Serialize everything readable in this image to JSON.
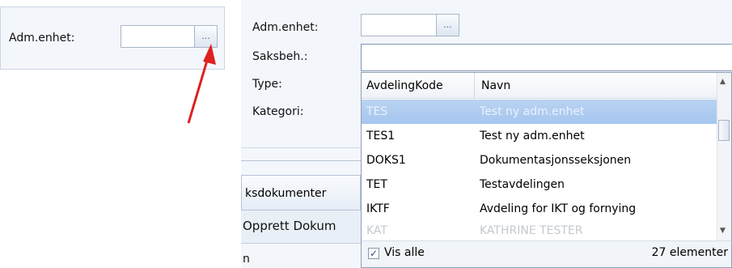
{
  "left_panel": {
    "adm_enhet_label": "Adm.enhet:",
    "browse_button": "..."
  },
  "right_panel": {
    "fields": {
      "adm_enhet_label": "Adm.enhet:",
      "saksbeh_label": "Saksbeh.:",
      "type_label": "Type:",
      "kategori_label": "Kategori:",
      "browse_button": "..."
    },
    "tabs": {
      "saksdokumenter": "ksdokumenter",
      "opprett": "Opprett Dokum",
      "bottom": "n"
    },
    "dropdown": {
      "columns": [
        "AvdelingKode",
        "Navn"
      ],
      "rows": [
        {
          "code": "TES",
          "name": "Test ny adm.enhet",
          "state": "selected"
        },
        {
          "code": "TES1",
          "name": "Test ny adm.enhet",
          "state": "normal"
        },
        {
          "code": "DOKS1",
          "name": "Dokumentasjonsseksjonen",
          "state": "normal"
        },
        {
          "code": "TET",
          "name": "Testavdelingen",
          "state": "normal"
        },
        {
          "code": "IKTF",
          "name": "Avdeling for IKT og fornying",
          "state": "normal"
        },
        {
          "code": "KAT",
          "name": "KATHRINE TESTER",
          "state": "dimmed"
        }
      ],
      "vis_alle_label": "Vis alle",
      "vis_alle_checked": true,
      "count_text": "27 elementer"
    }
  },
  "annotation": {
    "arrow_color": "#e02020"
  }
}
